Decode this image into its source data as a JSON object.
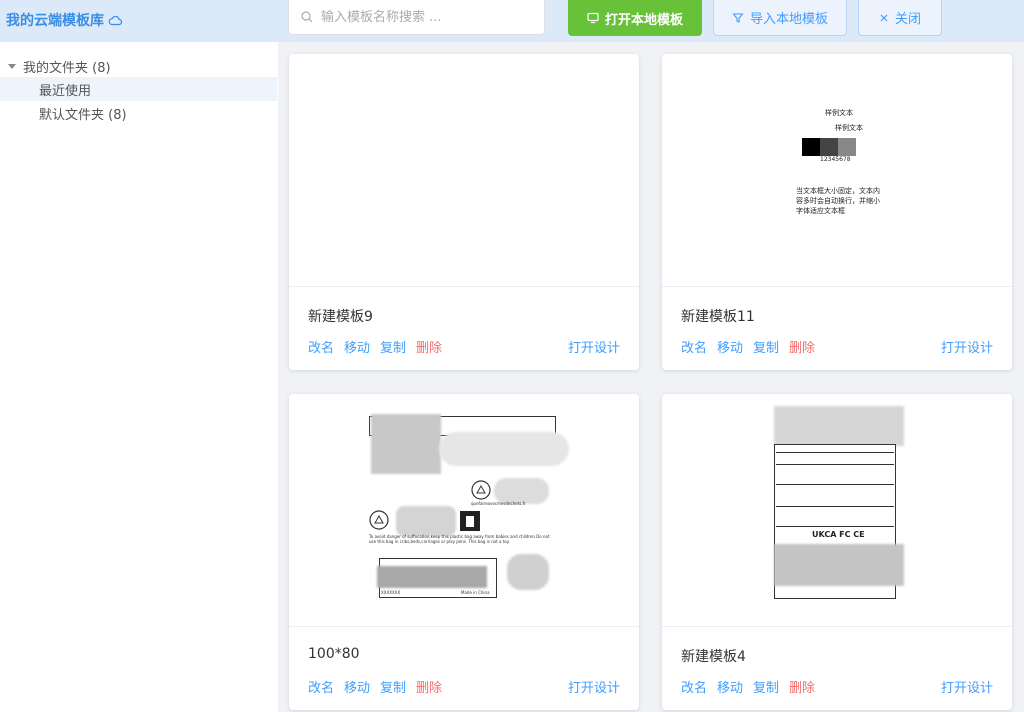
{
  "header": {
    "app_title": "我的云端模板库",
    "search_placeholder": "输入模板名称搜索 ...",
    "open_local_label": "打开本地模板",
    "import_local_label": "导入本地模板",
    "close_label": "关闭"
  },
  "sidebar": {
    "root_label": "我的文件夹 (8)",
    "recent_label": "最近使用",
    "default_folder_label": "默认文件夹 (8)"
  },
  "cards": [
    {
      "name": "新建模板9"
    },
    {
      "name": "新建模板11",
      "preview": {
        "text1": "样例文本",
        "text2": "样例文本",
        "barcode_text": "12345678",
        "paragraph": "当文本框大小固定，文本内容多时会自动换行，并缩小字体适应文本框"
      }
    },
    {
      "name": "100*80",
      "preview": {
        "website": "quefaireavecmesdechets.fr",
        "warning": "To avoid danger of suffocation,keep this plastic bag away from babies and children.Do not use this bag in cribs,beds,carriages or play pens. This bag is not a toy.",
        "made_in": "Made in China",
        "code": "XXXXXXX"
      }
    },
    {
      "name": "新建模板4",
      "preview": {
        "marks": "UKCA FC CE"
      }
    }
  ],
  "card_actions": {
    "rename": "改名",
    "move": "移动",
    "copy": "复制",
    "delete": "删除",
    "open_design": "打开设计"
  },
  "colors": {
    "accent": "#409eff",
    "success": "#67c23a",
    "danger": "#f56c6c",
    "header_bg": "#dbe9f9"
  }
}
